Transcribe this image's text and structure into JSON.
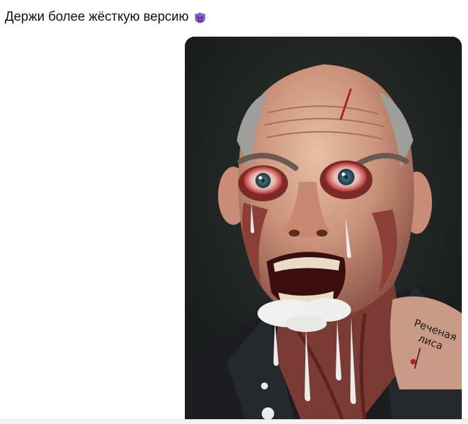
{
  "message": {
    "text": "Держи более жёсткую версию",
    "emoji_icon": "smiling-face-with-horns-icon"
  },
  "image": {
    "description_icon": "generated-portrait-image",
    "tattoo_text": [
      "Реченая",
      "лиса"
    ]
  },
  "colors": {
    "text": "#111111",
    "emoji_purple": "#8a5ad6",
    "image_background": "#1f2421",
    "bottom_strip": "#f3f3f3"
  }
}
